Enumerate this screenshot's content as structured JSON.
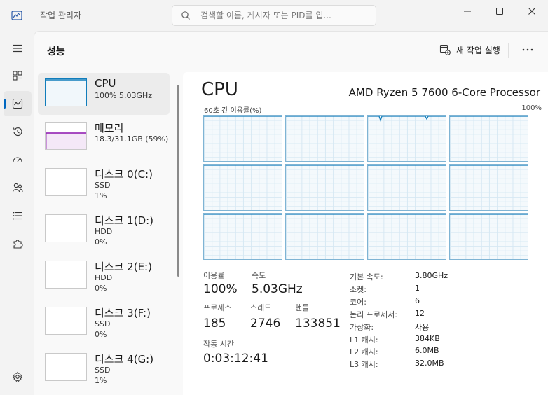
{
  "window": {
    "title": "작업 관리자"
  },
  "search": {
    "placeholder": "검색할 이름, 게시자 또는 PID를 입..."
  },
  "header": {
    "title": "성능",
    "new_task_label": "새 작업 실행"
  },
  "sidebar": {
    "items": [
      {
        "name": "CPU",
        "line1": "100% 5.03GHz",
        "line2": ""
      },
      {
        "name": "메모리",
        "line1": "18.3/31.1GB (59%)",
        "line2": ""
      },
      {
        "name": "디스크 0(C:)",
        "line1": "SSD",
        "line2": "1%"
      },
      {
        "name": "디스크 1(D:)",
        "line1": "HDD",
        "line2": "0%"
      },
      {
        "name": "디스크 2(E:)",
        "line1": "HDD",
        "line2": "0%"
      },
      {
        "name": "디스크 3(F:)",
        "line1": "SSD",
        "line2": "0%"
      },
      {
        "name": "디스크 4(G:)",
        "line1": "SSD",
        "line2": "1%"
      }
    ]
  },
  "detail": {
    "title": "CPU",
    "model": "AMD Ryzen 5 7600 6-Core Processor",
    "axis_left": "60초 간 이용률(%)",
    "axis_right": "100%",
    "core_graphs": 12,
    "stats": {
      "usage_label": "이용률",
      "usage_value": "100%",
      "speed_label": "속도",
      "speed_value": "5.03GHz",
      "processes_label": "프로세스",
      "processes_value": "185",
      "threads_label": "스레드",
      "threads_value": "2746",
      "handles_label": "핸들",
      "handles_value": "133851",
      "uptime_label": "작동 시간",
      "uptime_value": "0:03:12:41"
    },
    "specs": [
      {
        "label": "기본 속도:",
        "value": "3.80GHz"
      },
      {
        "label": "소켓:",
        "value": "1"
      },
      {
        "label": "코어:",
        "value": "6"
      },
      {
        "label": "논리 프로세서:",
        "value": "12"
      },
      {
        "label": "가상화:",
        "value": "사용"
      },
      {
        "label": "L1 캐시:",
        "value": "384KB"
      },
      {
        "label": "L2 캐시:",
        "value": "6.0MB"
      },
      {
        "label": "L3 캐시:",
        "value": "32.0MB"
      }
    ]
  },
  "colors": {
    "accent": "#0067c0",
    "cpu_line": "#117dbb",
    "memory_line": "#8b12ae"
  }
}
